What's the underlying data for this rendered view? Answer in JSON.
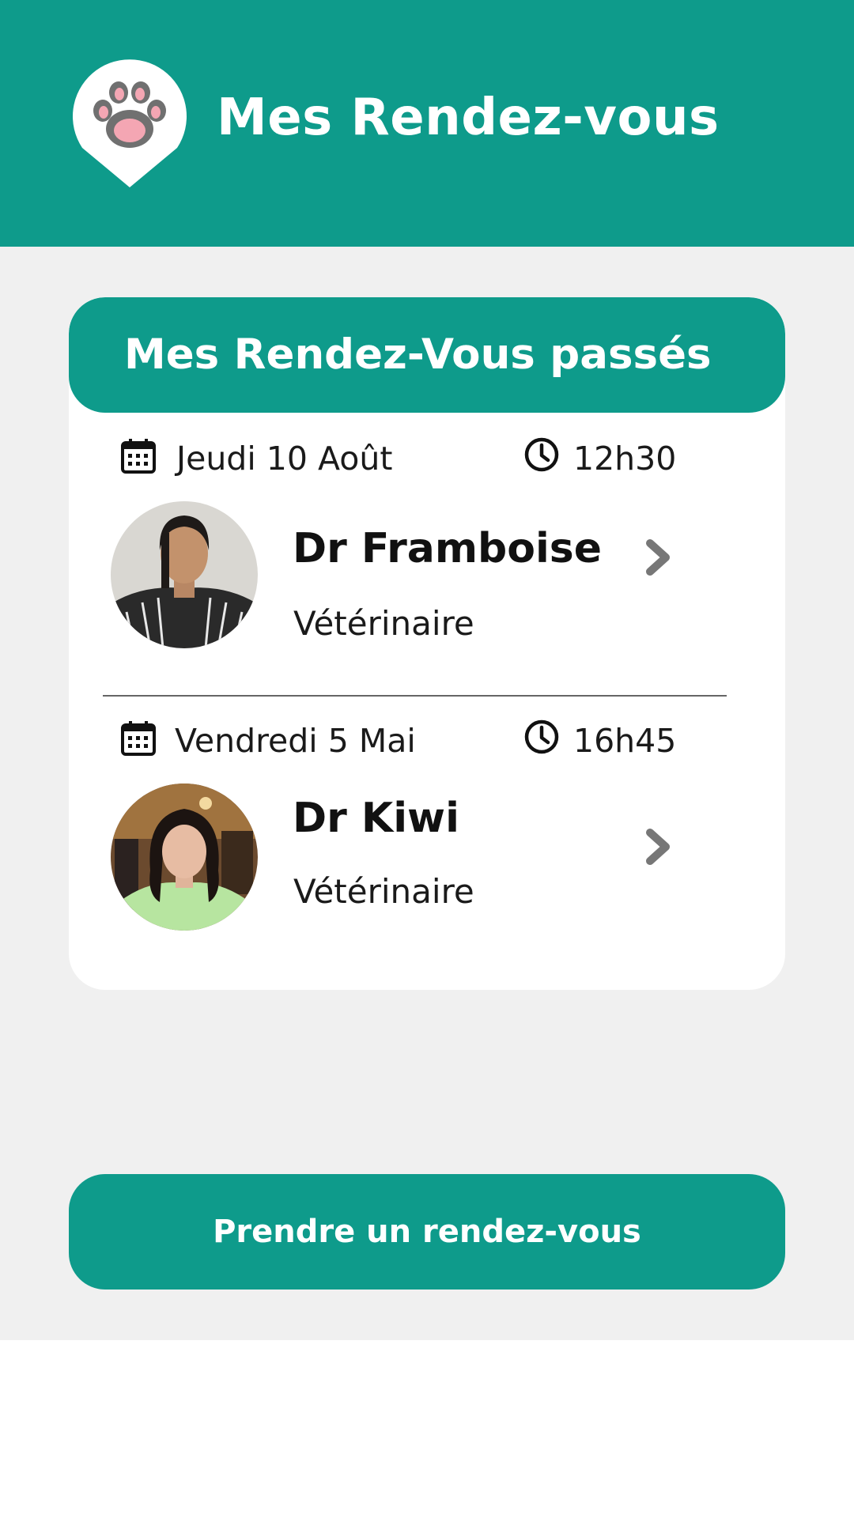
{
  "header": {
    "title": "Mes Rendez-vous",
    "logo_icon": "paw-pin-icon"
  },
  "past_appointments": {
    "title": "Mes Rendez-Vous passés",
    "items": [
      {
        "date": "Jeudi 10 Août",
        "time": "12h30",
        "doctor": "Dr Framboise",
        "role": "Vétérinaire",
        "avatar": "doctor-photo"
      },
      {
        "date": "Vendredi 5 Mai",
        "time": "16h45",
        "doctor": "Dr Kiwi",
        "role": "Vétérinaire",
        "avatar": "doctor-photo"
      }
    ]
  },
  "book_button": {
    "label": "Prendre un rendez-vous"
  },
  "colors": {
    "primary": "#0e9b8b",
    "background": "#f0f0f0",
    "card": "#ffffff",
    "chevron": "#777777"
  }
}
